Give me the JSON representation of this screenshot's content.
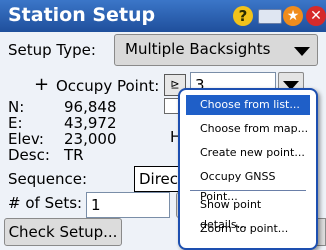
{
  "window": {
    "title": "Station Setup"
  },
  "titlebar_icons": [
    "help-icon",
    "keyboard-icon",
    "favorites-icon",
    "close-icon"
  ],
  "setup_type": {
    "label": "Setup Type:",
    "value": "Multiple Backsights"
  },
  "occupy_point": {
    "label": "Occupy Point:",
    "value": "3",
    "plus": "+"
  },
  "point_info": [
    {
      "label": "N:",
      "value": "96,848"
    },
    {
      "label": "E:",
      "value": "43,972"
    },
    {
      "label": "Elev:",
      "value": "23,000"
    },
    {
      "label": "Desc:",
      "value": "TR"
    }
  ],
  "partial": {
    "h_label": "H"
  },
  "sequence": {
    "label": "Sequence:",
    "value": "Direct C"
  },
  "num_sets": {
    "label": "# of Sets:",
    "value": "1"
  },
  "check_setup": {
    "label": "Check Setup..."
  },
  "menu": {
    "items": [
      {
        "label": "Choose from list...",
        "selected": true
      },
      {
        "label": "Choose from map...",
        "selected": false
      },
      {
        "label": "Create new point...",
        "selected": false
      },
      {
        "label": "Occupy GNSS Point...",
        "selected": false
      },
      {
        "label": "Show point details...",
        "selected": false
      },
      {
        "label": "Zoom to point...",
        "selected": false
      }
    ]
  }
}
